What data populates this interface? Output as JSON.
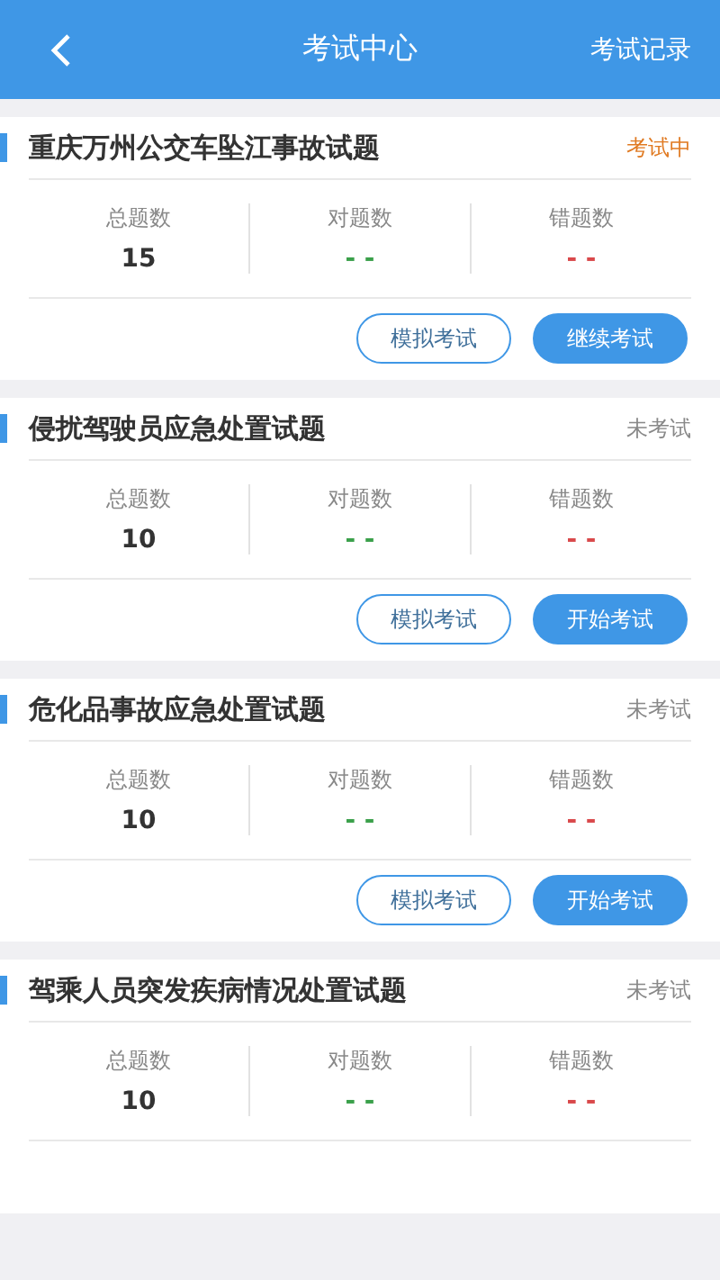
{
  "header": {
    "title": "考试中心",
    "action": "考试记录"
  },
  "exams": [
    {
      "title": "重庆万州公交车坠江事故试题",
      "status": {
        "kind": "in_progress",
        "text": "考试中"
      },
      "stats": [
        {
          "kind": "total",
          "label": "总题数",
          "value": "15"
        },
        {
          "kind": "correct",
          "label": "对题数",
          "value": "- -"
        },
        {
          "kind": "wrong",
          "label": "错题数",
          "value": "- -"
        }
      ],
      "buttons": [
        {
          "kind": "outline",
          "label": "模拟考试"
        },
        {
          "kind": "primary",
          "label": "继续考试"
        }
      ]
    },
    {
      "title": "侵扰驾驶员应急处置试题",
      "status": {
        "kind": "not_started",
        "text": "未考试"
      },
      "stats": [
        {
          "kind": "total",
          "label": "总题数",
          "value": "10"
        },
        {
          "kind": "correct",
          "label": "对题数",
          "value": "- -"
        },
        {
          "kind": "wrong",
          "label": "错题数",
          "value": "- -"
        }
      ],
      "buttons": [
        {
          "kind": "outline",
          "label": "模拟考试"
        },
        {
          "kind": "primary",
          "label": "开始考试"
        }
      ]
    },
    {
      "title": "危化品事故应急处置试题",
      "status": {
        "kind": "not_started",
        "text": "未考试"
      },
      "stats": [
        {
          "kind": "total",
          "label": "总题数",
          "value": "10"
        },
        {
          "kind": "correct",
          "label": "对题数",
          "value": "- -"
        },
        {
          "kind": "wrong",
          "label": "错题数",
          "value": "- -"
        }
      ],
      "buttons": [
        {
          "kind": "outline",
          "label": "模拟考试"
        },
        {
          "kind": "primary",
          "label": "开始考试"
        }
      ]
    },
    {
      "title": "驾乘人员突发疾病情况处置试题",
      "status": {
        "kind": "not_started",
        "text": "未考试"
      },
      "stats": [
        {
          "kind": "total",
          "label": "总题数",
          "value": "10"
        },
        {
          "kind": "correct",
          "label": "对题数",
          "value": "- -"
        },
        {
          "kind": "wrong",
          "label": "错题数",
          "value": "- -"
        }
      ]
    }
  ]
}
